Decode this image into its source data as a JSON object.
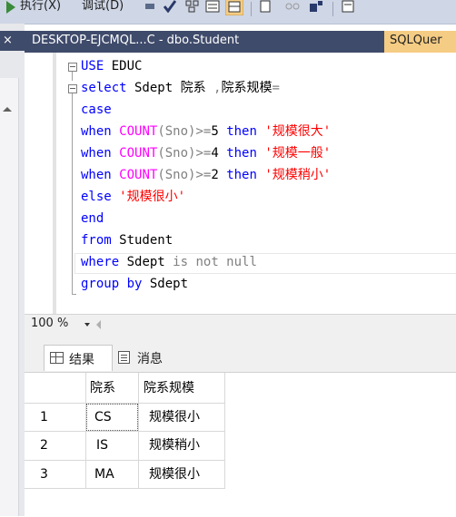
{
  "toolbar": {
    "execute_label": "执行(X)",
    "debug_label": "调试(D)"
  },
  "left_strip": {
    "close_glyph": "×"
  },
  "document_tabs": [
    {
      "label": "DESKTOP-EJCMQL...C - dbo.Student"
    },
    {
      "label": "SQLQuer"
    }
  ],
  "editor": {
    "lines": [
      {
        "parts": [
          {
            "t": "USE",
            "c": "kw"
          },
          {
            "t": " EDUC",
            "c": ""
          }
        ]
      },
      {
        "parts": [
          {
            "t": "select",
            "c": "kw"
          },
          {
            "t": " Sdept 院系 ",
            "c": ""
          },
          {
            "t": ",",
            "c": "gr"
          },
          {
            "t": "院系规模",
            "c": ""
          },
          {
            "t": "=",
            "c": "gr"
          }
        ]
      },
      {
        "parts": [
          {
            "t": "case",
            "c": "kw"
          }
        ]
      },
      {
        "parts": [
          {
            "t": "when",
            "c": "kw"
          },
          {
            "t": " ",
            "c": ""
          },
          {
            "t": "COUNT",
            "c": "fn"
          },
          {
            "t": "(Sno)",
            "c": "gr"
          },
          {
            "t": ">=",
            "c": "gr"
          },
          {
            "t": "5 ",
            "c": ""
          },
          {
            "t": "then",
            "c": "kw"
          },
          {
            "t": " '规模很大'",
            "c": "str"
          }
        ]
      },
      {
        "parts": [
          {
            "t": "when",
            "c": "kw"
          },
          {
            "t": " ",
            "c": ""
          },
          {
            "t": "COUNT",
            "c": "fn"
          },
          {
            "t": "(Sno)",
            "c": "gr"
          },
          {
            "t": ">=",
            "c": "gr"
          },
          {
            "t": "4 ",
            "c": ""
          },
          {
            "t": "then",
            "c": "kw"
          },
          {
            "t": " '规模一般'",
            "c": "str"
          }
        ]
      },
      {
        "parts": [
          {
            "t": "when",
            "c": "kw"
          },
          {
            "t": " ",
            "c": ""
          },
          {
            "t": "COUNT",
            "c": "fn"
          },
          {
            "t": "(Sno)",
            "c": "gr"
          },
          {
            "t": ">=",
            "c": "gr"
          },
          {
            "t": "2 ",
            "c": ""
          },
          {
            "t": "then",
            "c": "kw"
          },
          {
            "t": " '规模稍小'",
            "c": "str"
          }
        ]
      },
      {
        "parts": [
          {
            "t": "else",
            "c": "kw"
          },
          {
            "t": " '规模很小'",
            "c": "str"
          }
        ]
      },
      {
        "parts": [
          {
            "t": "end",
            "c": "kw"
          }
        ]
      },
      {
        "parts": [
          {
            "t": "from",
            "c": "kw"
          },
          {
            "t": " Student",
            "c": ""
          }
        ]
      },
      {
        "parts": [
          {
            "t": "where",
            "c": "kw"
          },
          {
            "t": " Sdept ",
            "c": ""
          },
          {
            "t": "is not null",
            "c": "gr"
          }
        ]
      },
      {
        "parts": [
          {
            "t": "group by",
            "c": "kw"
          },
          {
            "t": " Sdept",
            "c": ""
          }
        ]
      }
    ]
  },
  "zoom": {
    "value": "100 %"
  },
  "result_tabs": [
    {
      "label": "结果"
    },
    {
      "label": "消息"
    }
  ],
  "results": {
    "columns": [
      "院系",
      "院系规模"
    ],
    "rows": [
      {
        "num": "1",
        "cells": [
          "CS",
          "规模很小"
        ]
      },
      {
        "num": "2",
        "cells": [
          "IS",
          "规模稍小"
        ]
      },
      {
        "num": "3",
        "cells": [
          "MA",
          "规模很小"
        ]
      }
    ]
  },
  "colors": {
    "keyword": "#0000ff",
    "function": "#ff00ff",
    "string": "#ff0000",
    "operator": "#808080",
    "tab_bar": "#3f4b6b",
    "active_tab": "#f5cc84"
  }
}
